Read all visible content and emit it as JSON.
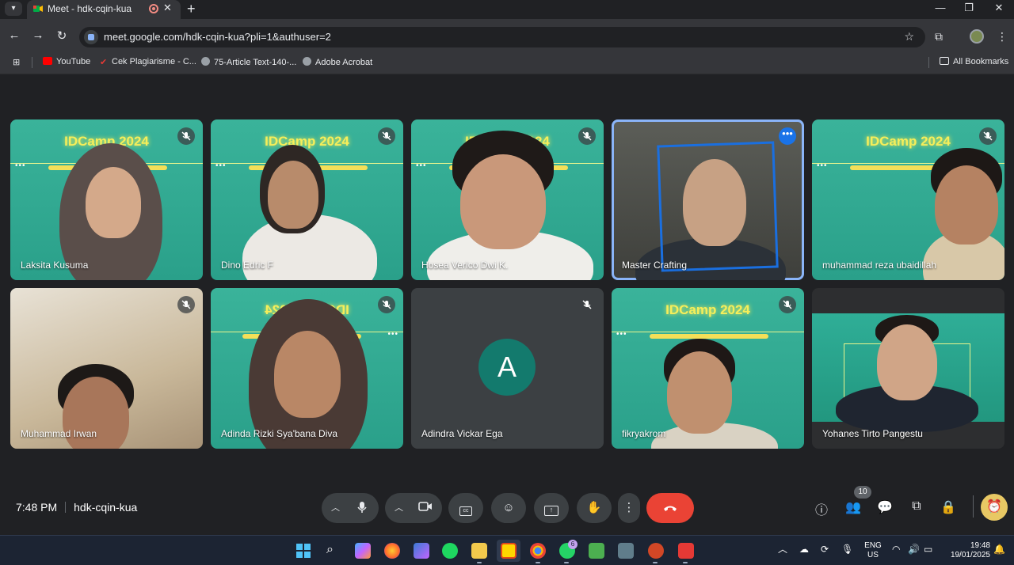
{
  "browser": {
    "tab_title": "Meet - hdk-cqin-kua",
    "tab_close": "✕",
    "new_tab": "+",
    "url": "meet.google.com/hdk-cqin-kua?pli=1&authuser=2",
    "window_controls": [
      "—",
      "❐",
      "✕"
    ],
    "bookmarks": [
      {
        "label": "YouTube",
        "icon": "youtube-icon",
        "color": "#ff0000"
      },
      {
        "label": "Cek Plagiarisme - C...",
        "icon": "check-icon",
        "color": "#e53935"
      },
      {
        "label": "75-Article Text-140-...",
        "icon": "globe-icon",
        "color": "#9aa0a6"
      },
      {
        "label": "Adobe Acrobat",
        "icon": "globe-icon",
        "color": "#9aa0a6"
      }
    ],
    "all_bookmarks": "All Bookmarks"
  },
  "meet": {
    "banner_text": "IDCamp 2024",
    "tiles": [
      {
        "name": "Laksita Kusuma",
        "muted": true
      },
      {
        "name": "Dino Edric F",
        "muted": true
      },
      {
        "name": "Hosea Verico Dwi K.",
        "muted": true
      },
      {
        "name": "Master Crafting",
        "muted": false,
        "active": true
      },
      {
        "name": "muhammad reza ubaidillah",
        "muted": true
      },
      {
        "name": "Muhammad Irwan",
        "muted": true
      },
      {
        "name": "Adinda Rizki Sya'bana Diva",
        "muted": true
      },
      {
        "name": "Adindra Vickar Ega",
        "muted": true,
        "avatar_letter": "A"
      },
      {
        "name": "fikryakrom",
        "muted": true
      },
      {
        "name": "Yohanes Tirto Pangestu",
        "muted": false
      }
    ],
    "bottom": {
      "time": "7:48 PM",
      "meeting_code": "hdk-cqin-kua",
      "people_count": "10"
    },
    "colors": {
      "accent": "#8ab4f8",
      "end_call": "#ea4335",
      "avatar_bg": "#137a6d"
    }
  },
  "taskbar": {
    "whatsapp_badge": "6",
    "language": "ENG",
    "region": "US",
    "clock_time": "19:48",
    "clock_date": "19/01/2025"
  }
}
